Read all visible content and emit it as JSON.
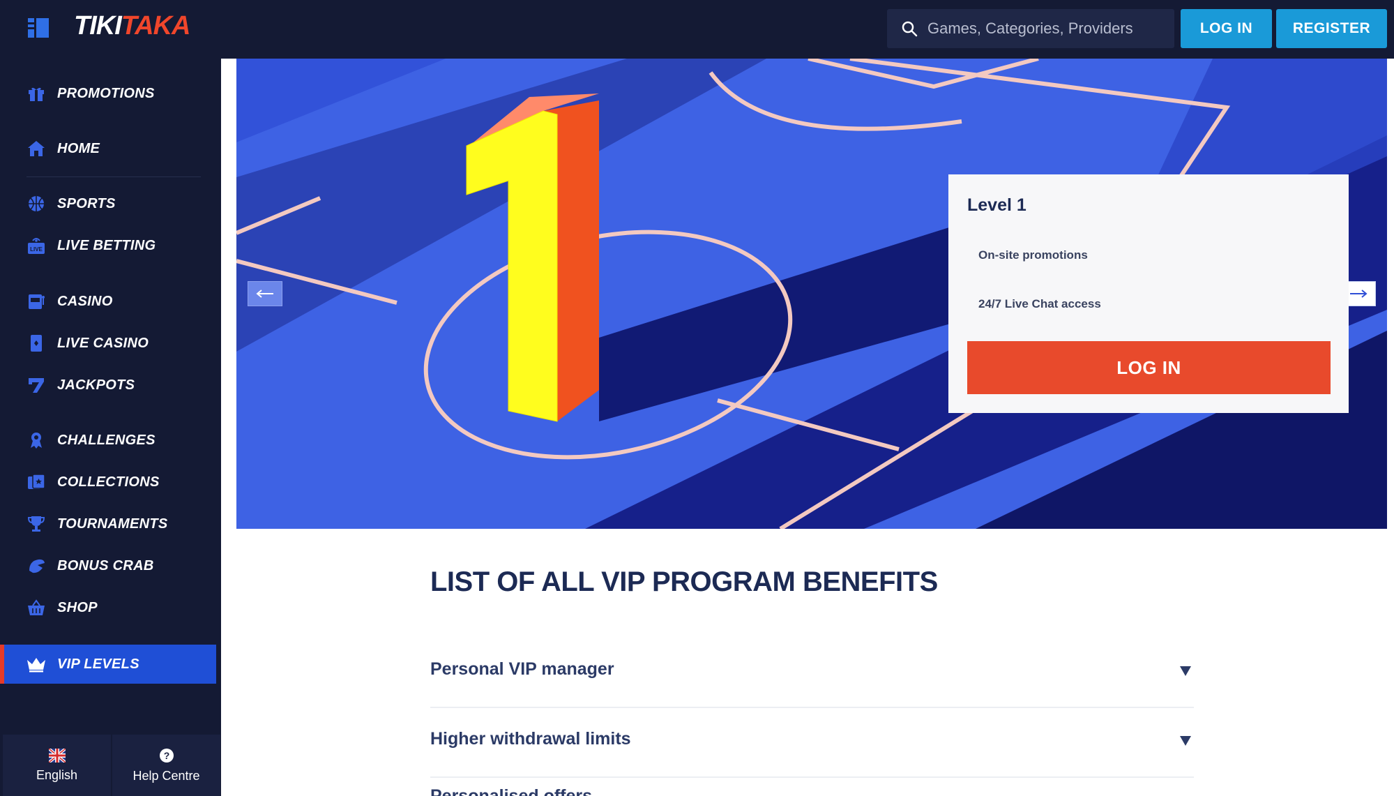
{
  "header": {
    "logo_part1": "TIKI",
    "logo_part2": "TAKA",
    "search_placeholder": "Games, Categories, Providers",
    "login_label": "LOG IN",
    "register_label": "REGISTER"
  },
  "sidebar": {
    "items": [
      {
        "label": "PROMOTIONS",
        "icon": "gift-icon"
      },
      {
        "label": "HOME",
        "icon": "home-icon"
      },
      {
        "label": "SPORTS",
        "icon": "basketball-icon"
      },
      {
        "label": "LIVE BETTING",
        "icon": "live-tv-icon"
      },
      {
        "label": "CASINO",
        "icon": "slot-machine-icon"
      },
      {
        "label": "LIVE CASINO",
        "icon": "playing-card-icon"
      },
      {
        "label": "JACKPOTS",
        "icon": "seven-icon"
      },
      {
        "label": "CHALLENGES",
        "icon": "badge-icon"
      },
      {
        "label": "COLLECTIONS",
        "icon": "cards-collection-icon"
      },
      {
        "label": "TOURNAMENTS",
        "icon": "trophy-icon"
      },
      {
        "label": "BONUS CRAB",
        "icon": "crab-claw-icon"
      },
      {
        "label": "SHOP",
        "icon": "basket-icon"
      },
      {
        "label": "VIP LEVELS",
        "icon": "crown-icon"
      }
    ],
    "active_item": "VIP LEVELS",
    "language_label": "English",
    "help_label": "Help Centre"
  },
  "hero": {
    "level_number": "1",
    "card_title": "Level 1",
    "perks": [
      "On-site promotions",
      "24/7 Live Chat access"
    ],
    "cta_label": "LOG IN"
  },
  "benefits": {
    "title": "LIST OF ALL VIP PROGRAM BENEFITS",
    "items": [
      "Personal VIP manager",
      "Higher withdrawal limits",
      "Personalised offers"
    ]
  },
  "colors": {
    "sidebar_bg": "#141a34",
    "accent_blue": "#1a9ad8",
    "active_nav": "#1f4fd6",
    "cta_red": "#e84a2c",
    "heading_navy": "#1c2a54"
  }
}
